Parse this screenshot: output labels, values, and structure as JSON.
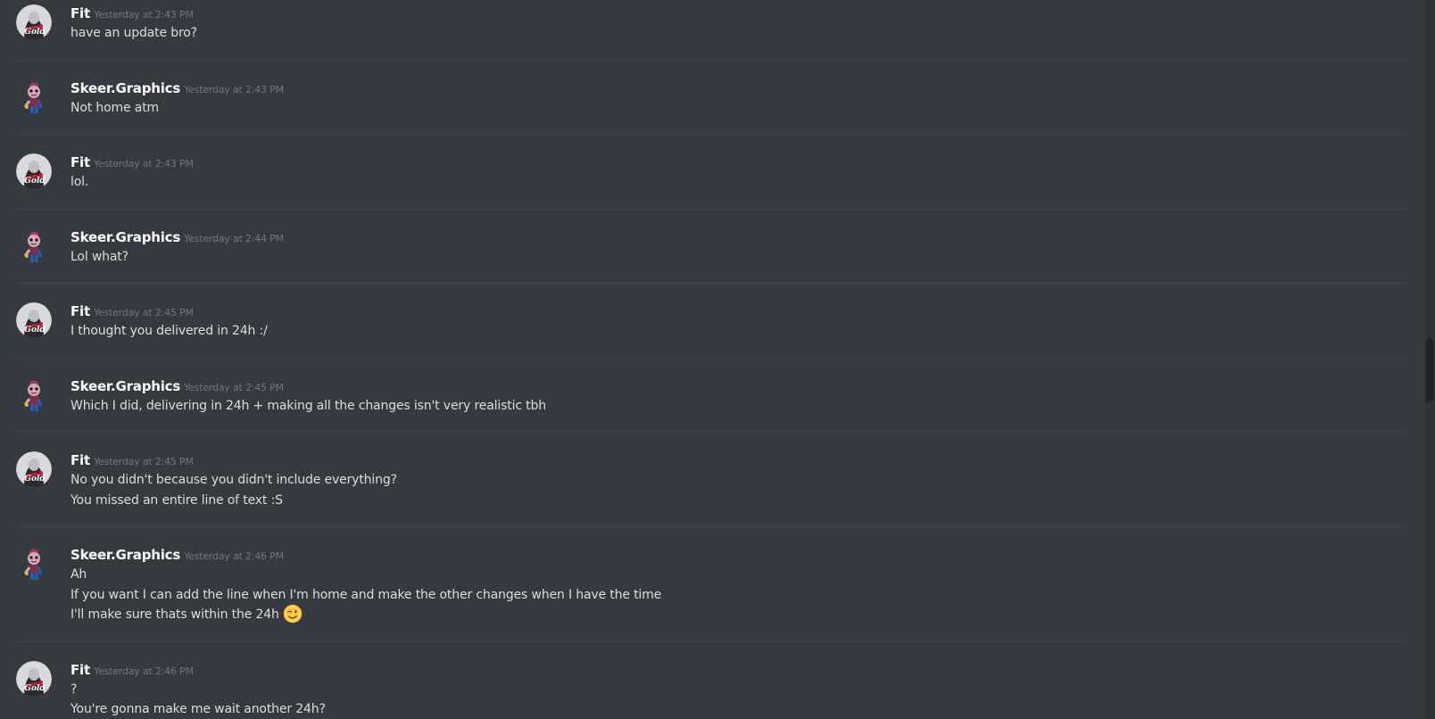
{
  "messages": [
    {
      "author": "Fit",
      "avatar": "fit",
      "timestamp": "Yesterday at 2:43 PM",
      "lines": [
        "have an update bro?"
      ]
    },
    {
      "author": "Skeer.Graphics",
      "avatar": "skeer",
      "timestamp": "Yesterday at 2:43 PM",
      "lines": [
        "Not home atm"
      ]
    },
    {
      "author": "Fit",
      "avatar": "fit",
      "timestamp": "Yesterday at 2:43 PM",
      "lines": [
        "lol."
      ]
    },
    {
      "author": "Skeer.Graphics",
      "avatar": "skeer",
      "timestamp": "Yesterday at 2:44 PM",
      "lines": [
        "Lol what?"
      ]
    },
    {
      "author": "Fit",
      "avatar": "fit",
      "timestamp": "Yesterday at 2:45 PM",
      "lines": [
        "I thought you delivered in 24h :/"
      ]
    },
    {
      "author": "Skeer.Graphics",
      "avatar": "skeer",
      "timestamp": "Yesterday at 2:45 PM",
      "lines": [
        "Which I did, delivering in 24h + making all the changes isn't very realistic tbh"
      ]
    },
    {
      "author": "Fit",
      "avatar": "fit",
      "timestamp": "Yesterday at 2:45 PM",
      "lines": [
        "No you didn't because you didn't include everything?",
        "You missed an entire line of text :S"
      ]
    },
    {
      "author": "Skeer.Graphics",
      "avatar": "skeer",
      "timestamp": "Yesterday at 2:46 PM",
      "lines": [
        "Ah",
        "If you want I can add the line when I'm home and make the other changes when I have the time",
        "I'll make sure thats within the 24h"
      ],
      "emoji": "wink-emoji"
    },
    {
      "author": "Fit",
      "avatar": "fit",
      "timestamp": "Yesterday at 2:46 PM",
      "lines": [
        "?",
        "You're gonna make me wait another 24h?"
      ]
    }
  ],
  "avatar_icons": {
    "fit": "fit-avatar-icon",
    "skeer": "skeer-avatar-icon"
  },
  "colors": {
    "background": "#36393f",
    "author": "#ffffff",
    "text": "#dcddde",
    "timestamp": "#72767d",
    "divider": "#40434a",
    "scrollbar_track": "#2e3338",
    "scrollbar_thumb": "#202225"
  },
  "scroll": {
    "thumb_start_fraction": 0.47,
    "thumb_size_fraction": 0.09
  }
}
